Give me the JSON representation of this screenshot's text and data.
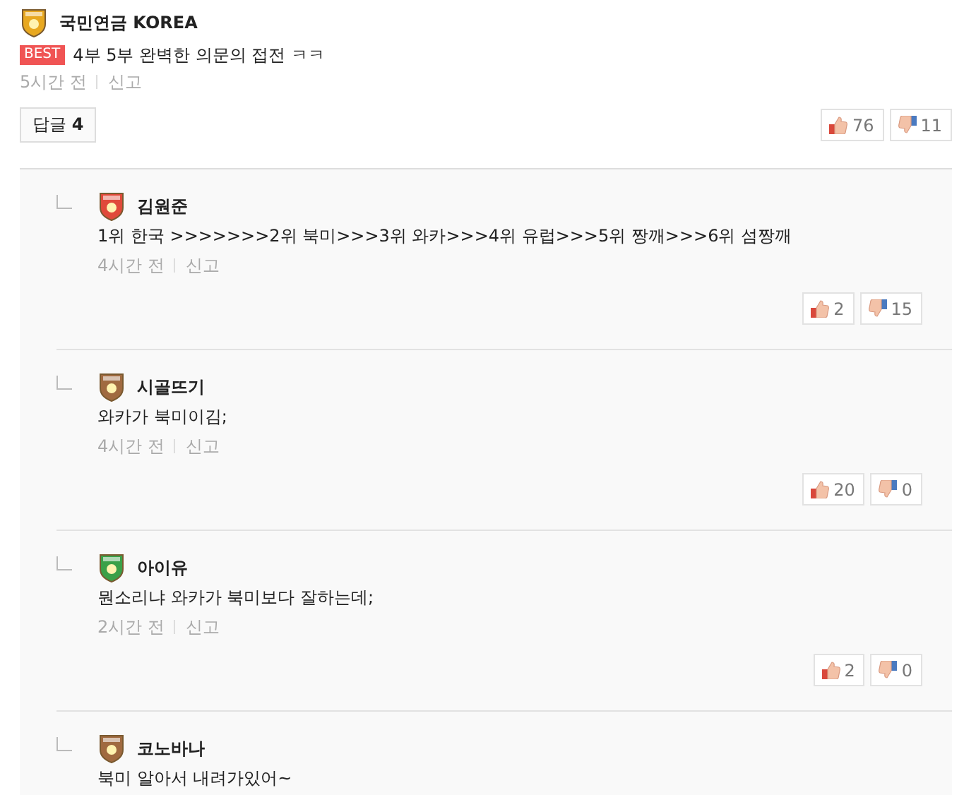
{
  "post": {
    "author": "국민연금 KOREA",
    "color": "#e8a820",
    "best_label": "BEST",
    "title": "4부 5부 완벽한 의문의 접전 ㅋㅋ",
    "time": "5시간 전",
    "report": "신고",
    "reply_button": "답글 **4**",
    "likes": "76",
    "dislikes": "11"
  },
  "replies": [
    {
      "author": "김원준",
      "color": "#e04a3a",
      "text": "1위 한국 >>>>>>>2위 북미>>>3위 와카>>>4위 유럽>>>5위 짱깨>>>6위 섬짱깨",
      "time": "4시간 전",
      "report": "신고",
      "likes": "2",
      "dislikes": "15"
    },
    {
      "author": "시골뜨기",
      "color": "#a06a40",
      "text": "와카가 북미이김;",
      "time": "4시간 전",
      "report": "신고",
      "likes": "20",
      "dislikes": "0"
    },
    {
      "author": "아이유",
      "color": "#3aa048",
      "text": "뭔소리냐 와카가 북미보다 잘하는데;",
      "time": "2시간 전",
      "report": "신고",
      "likes": "2",
      "dislikes": "0"
    },
    {
      "author": "코노바나",
      "color": "#a06a40",
      "text": "북미 알아서 내려가있어~"
    }
  ]
}
